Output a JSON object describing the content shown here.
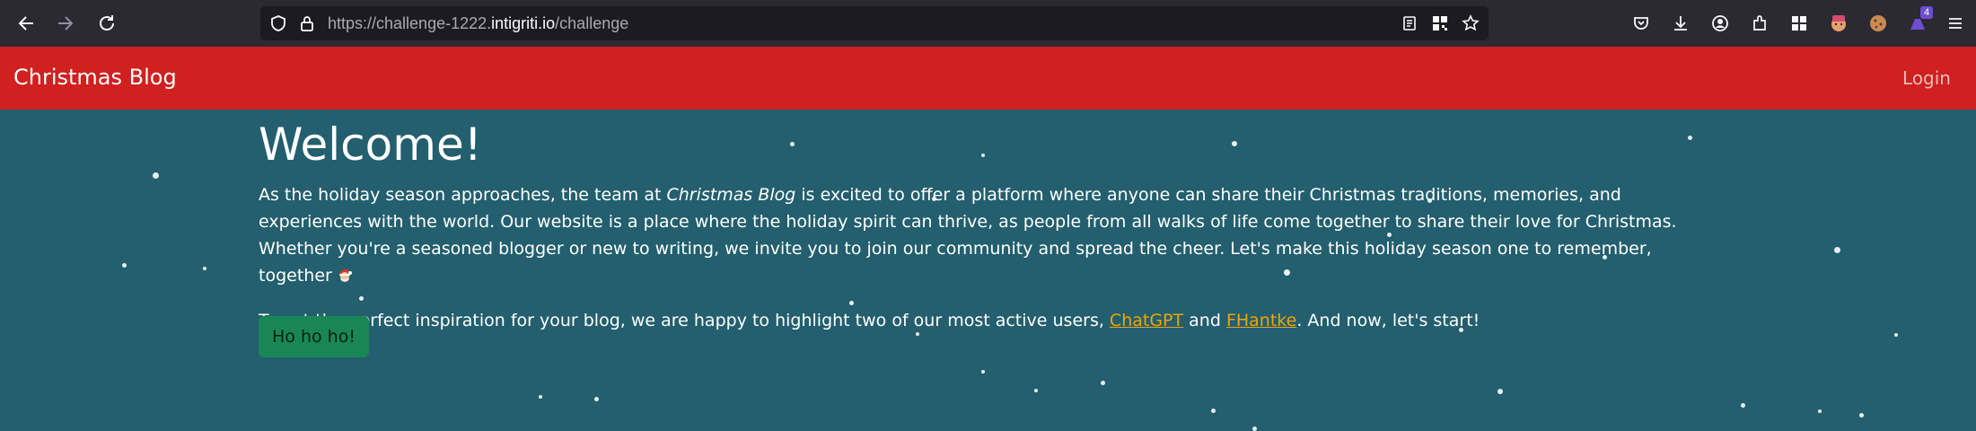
{
  "browser": {
    "url_prefix": "https://challenge-1222.",
    "url_host": "intigriti.io",
    "url_path": "/challenge",
    "extension_badge": "4",
    "icons": [
      "back-icon",
      "forward-icon",
      "reload-icon",
      "shield-icon",
      "lock-icon",
      "reader-icon",
      "qr-icon",
      "star-icon",
      "pocket-icon",
      "download-icon",
      "account-icon",
      "extensions-icon",
      "container-icon",
      "extension-avatar-icon",
      "cookie-icon",
      "extension-badge-icon",
      "menu-icon"
    ]
  },
  "navbar": {
    "brand": "Christmas Blog",
    "login": "Login"
  },
  "main": {
    "heading": "Welcome!",
    "para1": {
      "before": "As the holiday season approaches, the team at ",
      "emph": "Christmas Blog",
      "after": " is excited to offer a platform where anyone can share their Christmas traditions, memories, and experiences with the world. Our website is a place where the holiday spirit can thrive, as people from all walks of life come together to share their love for Christmas. Whether you're a seasoned blogger or new to writing, we invite you to join our community and spread the cheer. Let's make this holiday season one to remember, together"
    },
    "para2": {
      "before": "To get the perfect inspiration for your blog, we are happy to highlight two of our most active users, ",
      "user1": "ChatGPT",
      "middle": " and ",
      "user2": "FHantke",
      "after": ". And now, let's start!"
    },
    "button": "Ho ho ho!"
  },
  "colors": {
    "toolbar": "#2b2a33",
    "urlbar": "#1c1b22",
    "navbar": "#d0201f",
    "page": "#235f6e",
    "button": "#198754",
    "link": "#f0a500"
  }
}
